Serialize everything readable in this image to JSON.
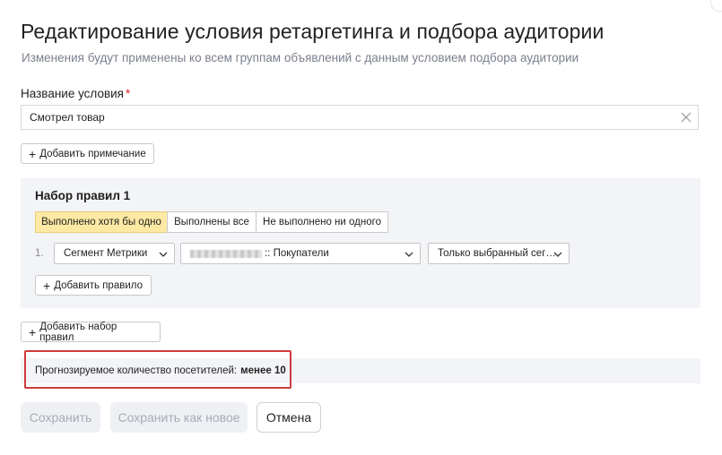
{
  "dialog": {
    "title": "Редактирование условия ретаргетинга и подбора аудитории",
    "subtitle": "Изменения будут применены ко всем группам объявлений с данным условием подбора аудитории"
  },
  "condition_name": {
    "label": "Название условия",
    "required_mark": "*",
    "value": "Смотрел товар"
  },
  "add_note_button": {
    "plus": "+",
    "label": "Добавить примечание"
  },
  "rule_set": {
    "title": "Набор правил 1",
    "modes": [
      {
        "label": "Выполнено хотя бы одно",
        "active": true
      },
      {
        "label": "Выполнены все",
        "active": false
      },
      {
        "label": "Не выполнено ни одного",
        "active": false
      }
    ],
    "rules": [
      {
        "number": "1.",
        "type": "Сегмент Метрики",
        "segment": ":: Покупатели",
        "scope": "Только выбранный сег…"
      }
    ],
    "add_rule": {
      "plus": "+",
      "label": "Добавить правило"
    }
  },
  "add_rule_set_button": {
    "plus": "+",
    "label": "Добавить набор правил"
  },
  "forecast": {
    "label": "Прогнозируемое количество посетителей:",
    "value": "менее 10"
  },
  "actions": {
    "save": "Сохранить",
    "save_as_new": "Сохранить как новое",
    "cancel": "Отмена"
  }
}
